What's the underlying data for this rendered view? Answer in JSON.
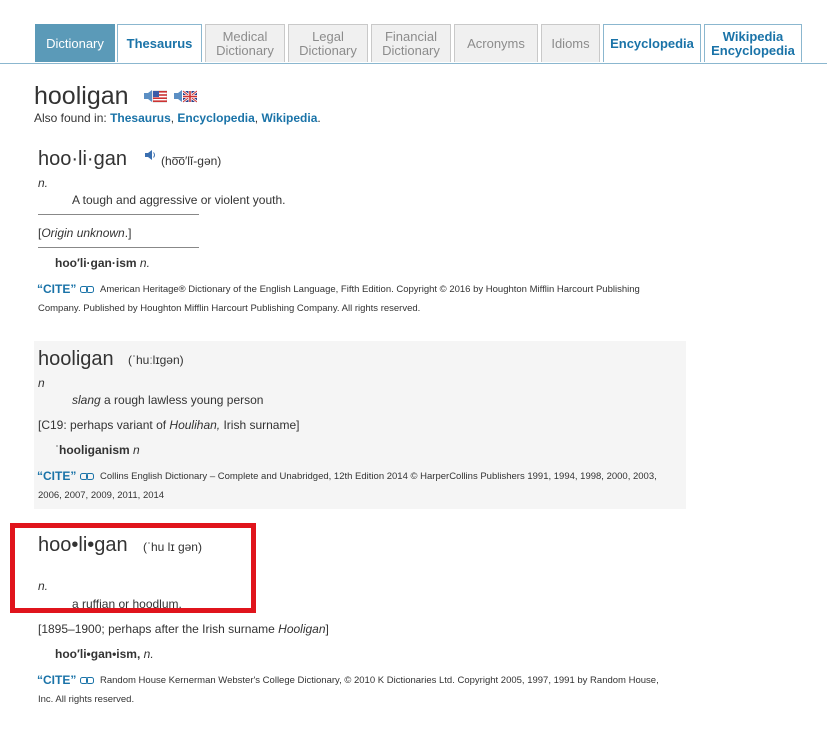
{
  "tabs": [
    {
      "line1": "Dictionary",
      "line2": ""
    },
    {
      "line1": "Thesaurus",
      "line2": ""
    },
    {
      "line1": "Medical",
      "line2": "Dictionary"
    },
    {
      "line1": "Legal",
      "line2": "Dictionary"
    },
    {
      "line1": "Financial",
      "line2": "Dictionary"
    },
    {
      "line1": "Acronyms",
      "line2": ""
    },
    {
      "line1": "Idioms",
      "line2": ""
    },
    {
      "line1": "Encyclopedia",
      "line2": ""
    },
    {
      "line1": "Wikipedia",
      "line2": "Encyclopedia"
    }
  ],
  "headword": "hooligan",
  "also_found": {
    "prefix": "Also found in: ",
    "links": [
      "Thesaurus",
      "Encyclopedia",
      "Wikipedia"
    ],
    "sep": ", ",
    "end": "."
  },
  "entry1": {
    "word": "hoo·li·gan",
    "pron": "(ho͞o′lĭ-gən)",
    "pos": "n.",
    "def": "A tough and aggressive or violent youth.",
    "origin_open": "[",
    "origin_it": "Origin unknown",
    "origin_close": ".]",
    "deriv_word": "hoo′li·gan·ism",
    "deriv_pos": "n.",
    "cite_label": "“CITE”",
    "cite_text": "American Heritage® Dictionary of the English Language, Fifth Edition. Copyright © 2016 by Houghton Mifflin Harcourt Publishing Company. Published by Houghton Mifflin Harcourt Publishing Company. All rights reserved."
  },
  "entry2": {
    "word": "hooligan",
    "pron": "(ˈhuːlɪɡən)",
    "pos": "n",
    "def_it": "slang",
    "def": " a rough lawless young person",
    "origin_a": "[C19: perhaps variant of ",
    "origin_it": "Houlihan,",
    "origin_b": " Irish surname]",
    "deriv_mark": "ˈ",
    "deriv_word": "hooliganism",
    "deriv_pos": "n",
    "cite_label": "“CITE”",
    "cite_text": "Collins English Dictionary – Complete and Unabridged, 12th Edition 2014 © HarperCollins Publishers 1991, 1994, 1998, 2000, 2003, 2006, 2007, 2009, 2011, 2014"
  },
  "entry3": {
    "word": "hoo•li•gan",
    "pron": "(ˈhu lɪ gən)",
    "pos": "n.",
    "def": "a ruffian or hoodlum.",
    "origin_a": "[1895–1900; perhaps after the Irish surname ",
    "origin_it": "Hooligan",
    "origin_b": "]",
    "deriv_word": "hoo′li•gan•ism,",
    "deriv_pos": "n.",
    "cite_label": "“CITE”",
    "cite_text": "Random House Kernerman Webster's College Dictionary, © 2010 K Dictionaries Ltd. Copyright 2005, 1997, 1991 by Random House, Inc. All rights reserved."
  },
  "colors": {
    "accent": "#1a73a8",
    "active_tab": "#5b9ab8",
    "highlight": "#e0141c"
  }
}
